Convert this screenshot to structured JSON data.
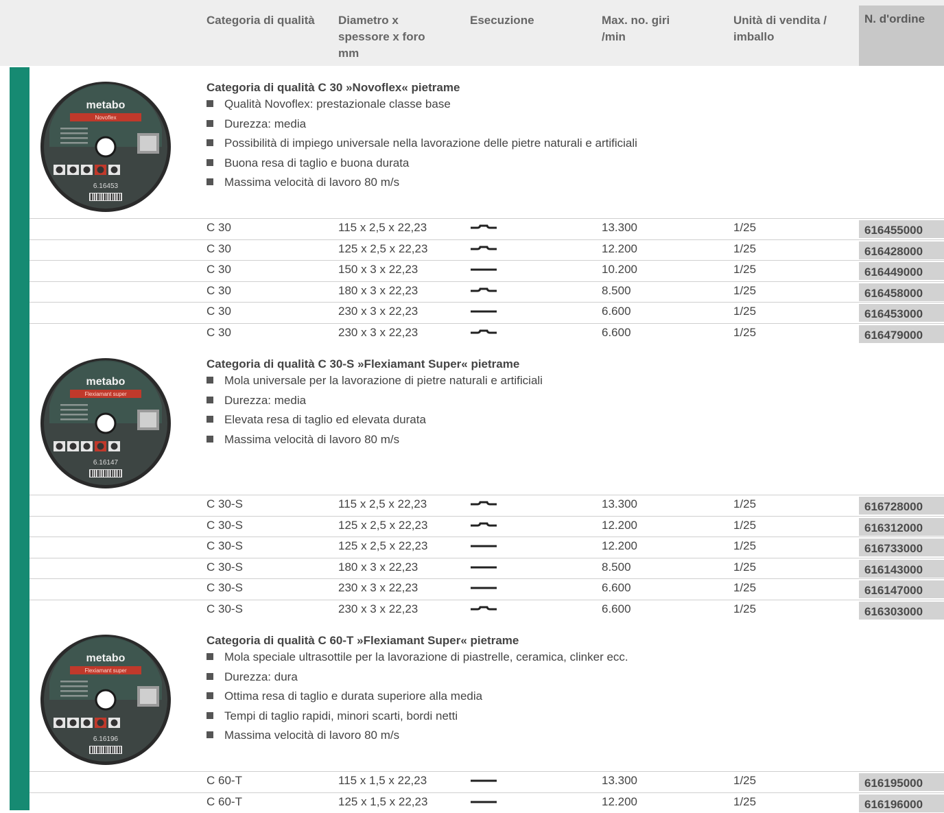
{
  "header": {
    "col_category": "Categoria di qualità",
    "col_dimensions": "Diametro x\nspessore x foro\nmm",
    "col_execution": "Esecuzione",
    "col_rpm": "Max. no. giri\n/min",
    "col_unit": "Unità di vendita /\nimballo",
    "col_order": "N. d'ordine"
  },
  "sections": [
    {
      "title": "Categoria di qualità C 30 »Novoflex« pietrame",
      "bullets": [
        "Qualità Novoflex: prestazionale classe base",
        "Durezza: media",
        "Possibilità di impiego universale nella lavorazione delle pietre naturali e artificiali",
        "Buona resa di taglio e buona durata",
        "Massima velocità di lavoro 80 m/s"
      ],
      "disc": {
        "brand": "metabo",
        "product": "Novoflex",
        "code": "6.16453",
        "label_color": "#c0392b"
      },
      "rows": [
        {
          "category": "C 30",
          "dimensions": "115 x 2,5 x 22,23",
          "execution": "depressed-center",
          "rpm": "13.300",
          "unit": "1/25",
          "order": "616455000"
        },
        {
          "category": "C 30",
          "dimensions": "125 x 2,5 x 22,23",
          "execution": "depressed-center",
          "rpm": "12.200",
          "unit": "1/25",
          "order": "616428000"
        },
        {
          "category": "C 30",
          "dimensions": "150 x 3 x 22,23",
          "execution": "straight",
          "rpm": "10.200",
          "unit": "1/25",
          "order": "616449000"
        },
        {
          "category": "C 30",
          "dimensions": "180 x 3 x 22,23",
          "execution": "depressed-center",
          "rpm": "8.500",
          "unit": "1/25",
          "order": "616458000"
        },
        {
          "category": "C 30",
          "dimensions": "230 x 3 x 22,23",
          "execution": "straight",
          "rpm": "6.600",
          "unit": "1/25",
          "order": "616453000"
        },
        {
          "category": "C 30",
          "dimensions": "230 x 3 x 22,23",
          "execution": "depressed-center",
          "rpm": "6.600",
          "unit": "1/25",
          "order": "616479000"
        }
      ]
    },
    {
      "title": "Categoria di qualità C 30-S »Flexiamant Super« pietrame",
      "bullets": [
        "Mola universale per la lavorazione di pietre naturali e artificiali",
        "Durezza: media",
        "Elevata resa di taglio ed elevata durata",
        "Massima velocità di lavoro 80 m/s"
      ],
      "disc": {
        "brand": "metabo",
        "product": "Flexiamant super",
        "code": "6.16147",
        "label_color": "#c0392b"
      },
      "rows": [
        {
          "category": "C 30-S",
          "dimensions": "115 x 2,5 x 22,23",
          "execution": "depressed-center",
          "rpm": "13.300",
          "unit": "1/25",
          "order": "616728000"
        },
        {
          "category": "C 30-S",
          "dimensions": "125 x 2,5 x 22,23",
          "execution": "depressed-center",
          "rpm": "12.200",
          "unit": "1/25",
          "order": "616312000"
        },
        {
          "category": "C 30-S",
          "dimensions": "125 x 2,5 x 22,23",
          "execution": "straight",
          "rpm": "12.200",
          "unit": "1/25",
          "order": "616733000"
        },
        {
          "category": "C 30-S",
          "dimensions": "180 x 3 x 22,23",
          "execution": "straight",
          "rpm": "8.500",
          "unit": "1/25",
          "order": "616143000"
        },
        {
          "category": "C 30-S",
          "dimensions": "230 x 3 x 22,23",
          "execution": "straight",
          "rpm": "6.600",
          "unit": "1/25",
          "order": "616147000"
        },
        {
          "category": "C 30-S",
          "dimensions": "230 x 3 x 22,23",
          "execution": "depressed-center",
          "rpm": "6.600",
          "unit": "1/25",
          "order": "616303000"
        }
      ]
    },
    {
      "title": "Categoria di qualità C 60-T »Flexiamant Super« pietrame",
      "bullets": [
        "Mola speciale ultrasottile per la lavorazione di piastrelle, ceramica, clinker ecc.",
        "Durezza: dura",
        "Ottima resa di taglio e durata superiore alla media",
        "Tempi di taglio rapidi, minori scarti, bordi netti",
        "Massima velocità di lavoro 80 m/s"
      ],
      "disc": {
        "brand": "metabo",
        "product": "Flexiamant super",
        "code": "6.16196",
        "label_color": "#c0392b"
      },
      "rows": [
        {
          "category": "C 60-T",
          "dimensions": "115 x 1,5 x 22,23",
          "execution": "straight",
          "rpm": "13.300",
          "unit": "1/25",
          "order": "616195000"
        },
        {
          "category": "C 60-T",
          "dimensions": "125 x 1,5 x 22,23",
          "execution": "straight",
          "rpm": "12.200",
          "unit": "1/25",
          "order": "616196000"
        }
      ]
    }
  ]
}
